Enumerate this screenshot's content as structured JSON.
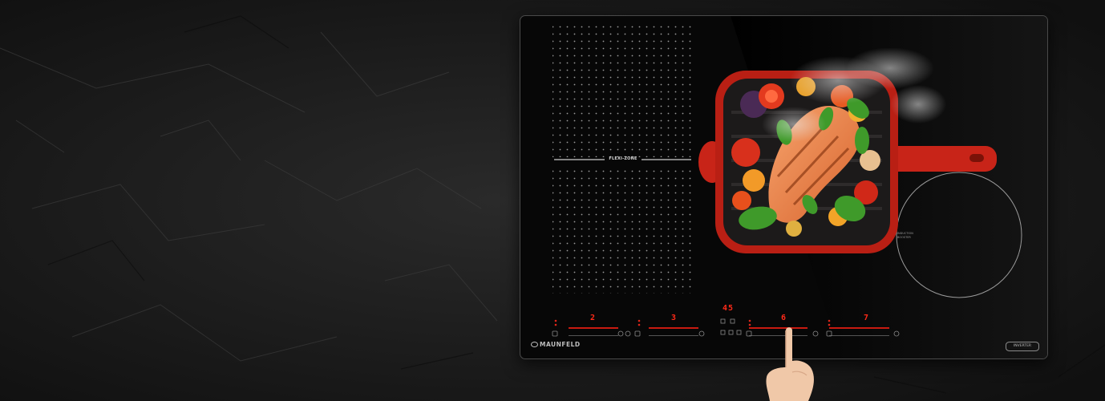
{
  "hob": {
    "zone_label": "FLEXI-ZONE",
    "booster_label_1": "INDUCTION",
    "booster_label_2": "BOOSTER",
    "brand": "MAUNFELD",
    "badge": "INVERTER"
  },
  "display": {
    "zone1_level": "2",
    "zone2_level": "3",
    "timer": "45",
    "zone3_level": "6",
    "zone4_level": "7"
  },
  "colors": {
    "accent_red": "#ff2a18",
    "glass": "#070707",
    "pan_red": "#d8281a"
  }
}
